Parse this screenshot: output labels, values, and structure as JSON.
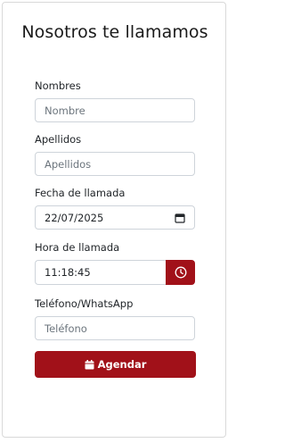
{
  "form": {
    "title": "Nosotros te llamamos",
    "fields": {
      "nombres": {
        "label": "Nombres",
        "placeholder": "Nombre"
      },
      "apellidos": {
        "label": "Apellidos",
        "placeholder": "Apellidos"
      },
      "fecha": {
        "label": "Fecha de llamada",
        "value": "22/07/2025",
        "icon": "calendar-icon"
      },
      "hora": {
        "label": "Hora de llamada",
        "value": "11:18:45",
        "icon": "clock-icon"
      },
      "telefono": {
        "label": "Teléfono/WhatsApp",
        "placeholder": "Teléfono"
      }
    },
    "submit": {
      "label": "Agendar",
      "icon": "calendar-icon"
    }
  },
  "colors": {
    "accent": "#a11119",
    "border": "#ced4da",
    "placeholder": "#6c757d"
  }
}
